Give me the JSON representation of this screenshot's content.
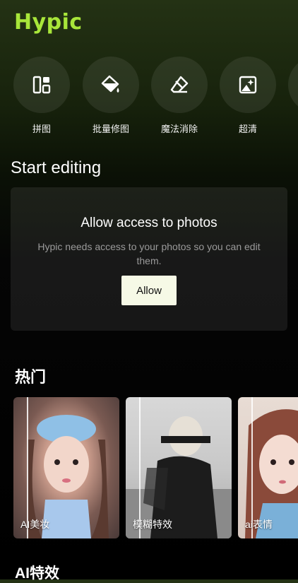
{
  "app": {
    "logo_text": "Hypic",
    "accent": "#a8e63a"
  },
  "tools": [
    {
      "label": "拼图",
      "icon": "collage-icon"
    },
    {
      "label": "批量修图",
      "icon": "paint-bucket-icon"
    },
    {
      "label": "魔法消除",
      "icon": "eraser-icon"
    },
    {
      "label": "超清",
      "icon": "image-enhance-icon"
    }
  ],
  "start_editing": {
    "title": "Start editing",
    "card_title": "Allow access to photos",
    "card_desc": "Hypic needs access to your photos so you can edit them.",
    "allow_label": "Allow"
  },
  "hot": {
    "title": "热门",
    "cards": [
      {
        "caption": "AI美妆"
      },
      {
        "caption": "模糊特效"
      },
      {
        "caption": "ai表情"
      }
    ]
  },
  "ai_effects": {
    "title": "AI特效"
  }
}
